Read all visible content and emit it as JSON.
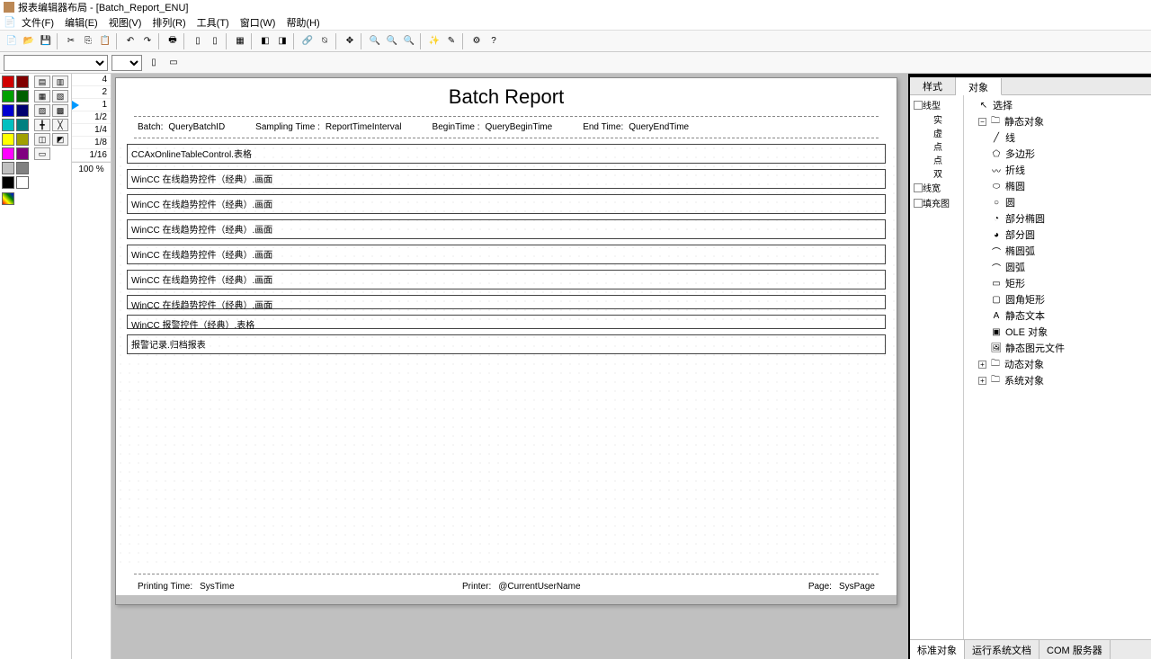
{
  "app": {
    "title": "报表编辑器布局 - [Batch_Report_ENU]"
  },
  "menu": {
    "file": "文件(F)",
    "edit": "编辑(E)",
    "view": "视图(V)",
    "arrange": "排列(R)",
    "tools": "工具(T)",
    "window": "窗口(W)",
    "help": "帮助(H)"
  },
  "ruler": {
    "r4": "4",
    "r2": "2",
    "r1": "1",
    "r1_2": "1/2",
    "r1_4": "1/4",
    "r1_8": "1/8",
    "r1_16": "1/16",
    "zoom": "100 %"
  },
  "report": {
    "title": "Batch Report",
    "batch_lbl": "Batch:",
    "batch_val": "QueryBatchID",
    "samp_lbl": "Sampling Time :",
    "samp_val": "ReportTimeInterval",
    "begin_lbl": "BeginTime :",
    "begin_val": "QueryBeginTime",
    "end_lbl": "End Time:",
    "end_val": "QueryEndTime",
    "blocks": [
      "CCAxOnlineTableControl.表格",
      "WinCC 在线趋势控件（经典）.画面",
      "WinCC 在线趋势控件（经典）.画面",
      "WinCC 在线趋势控件（经典）.画面",
      "WinCC 在线趋势控件（经典）.画面",
      "WinCC 在线趋势控件（经典）.画面",
      "WinCC 在线趋势控件（经典）.画面",
      "WinCC 报警控件（经典）.表格",
      "报警记录.归档报表"
    ],
    "footer": {
      "print_lbl": "Printing Time:",
      "print_val": "SysTime",
      "printer_lbl": "Printer:",
      "printer_val": "@CurrentUserName",
      "page_lbl": "Page:",
      "page_val": "SysPage"
    }
  },
  "right": {
    "tab_style": "样式",
    "tab_object": "对象",
    "style_tree": {
      "n1": "线型",
      "n1a": "实",
      "n1b": "虚",
      "n1c": "点",
      "n1d": "点",
      "n1e": "双",
      "n2": "线宽",
      "n3": "填充图"
    },
    "obj_tree": {
      "select": "选择",
      "static": "静态对象",
      "line": "线",
      "polygon": "多边形",
      "polyline": "折线",
      "ellipse": "椭圆",
      "circle": "圆",
      "partial_ellipse": "部分椭圆",
      "partial_circle": "部分圆",
      "ellipse_arc": "椭圆弧",
      "arc": "圆弧",
      "rect": "矩形",
      "round_rect": "圆角矩形",
      "static_text": "静态文本",
      "ole": "OLE 对象",
      "metafile": "静态图元文件",
      "dynamic": "动态对象",
      "system": "系统对象"
    },
    "bottom_tabs": {
      "t1": "标准对象",
      "t2": "运行系统文档",
      "t3": "COM 服务器"
    }
  },
  "colors": {
    "grid": [
      [
        "#d00000",
        "#800000"
      ],
      [
        "#00a000",
        "#006000"
      ],
      [
        "#0000d0",
        "#000070"
      ],
      [
        "#00c0c0",
        "#008080"
      ],
      [
        "#ffff00",
        "#a0a000"
      ],
      [
        "#ff00ff",
        "#800080"
      ],
      [
        "#c0c0c0",
        "#808080"
      ],
      [
        "#000000",
        "#ffffff"
      ]
    ]
  }
}
